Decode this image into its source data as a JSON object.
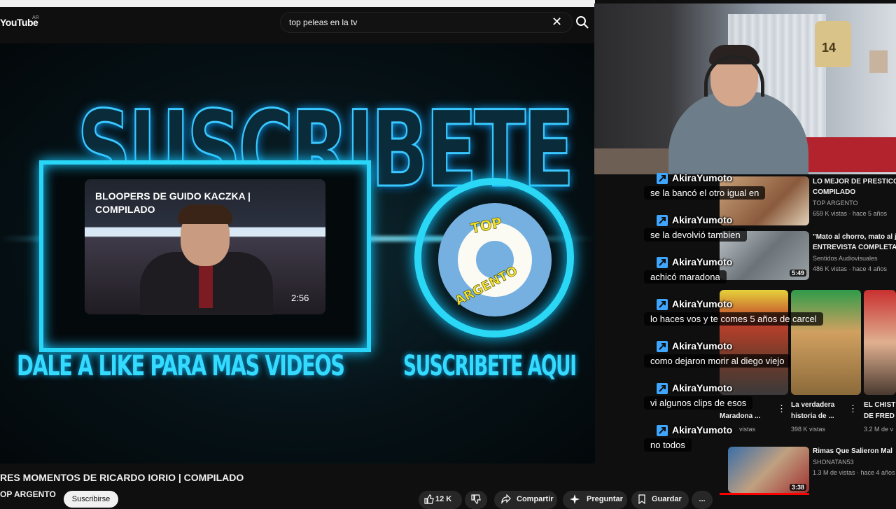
{
  "header": {
    "logo": "YouTube",
    "logo_region": "AR",
    "search_value": "top peleas en la tv"
  },
  "player": {
    "big_text": "SUSCRIBETE",
    "endscreen_video": {
      "title": "BLOOPERS DE GUIDO KACZKA | COMPILADO",
      "duration": "2:56"
    },
    "channel_logo_top": "TOP",
    "channel_logo_bottom": "ARGENTO",
    "cta_like": "DALE A LIKE PARA MAS VIDEOS",
    "cta_subscribe": "SUSCRIBETE AQUI"
  },
  "video": {
    "title": "RES MOMENTOS DE RICARDO IORIO | COMPILADO",
    "channel": "OP ARGENTO",
    "subscribe_label": "Suscribirse",
    "likes": "12 K",
    "share_label": "Compartir",
    "ask_label": "Preguntar",
    "save_label": "Guardar",
    "more_label": "..."
  },
  "webcam": {
    "jersey_number": "14"
  },
  "recommendations": [
    {
      "title1": "LO MEJOR DE PRESTICO",
      "title2": "COMPILADO",
      "channel": "TOP ARGENTO",
      "meta": "659 K vistas · hace 5 años"
    },
    {
      "title1": "\"Mato al chorro, mato al j",
      "title2": "ENTREVISTA COMPLETA",
      "channel": "Sentidos Audiovisuales",
      "meta": "486 K vistas · hace 4 años",
      "duration": "5:49"
    },
    {
      "title1": "Maradona ...",
      "channel": "",
      "meta": "vistas"
    },
    {
      "title1": "La verdadera",
      "title2": "historia de ...",
      "meta": "398 K vistas"
    },
    {
      "title1": "EL CHIST",
      "title2": "DE FRED",
      "meta": "3.2 M de v"
    },
    {
      "title1": "Rimas Que Salieron Mal",
      "channel": "SHONATAN53",
      "meta": "1.3 M de vistas · hace 4 años",
      "duration": "3:38"
    }
  ],
  "chat": [
    {
      "user": "AkiraYumoto",
      "message": "se la bancó el otro igual en"
    },
    {
      "user": "AkiraYumoto",
      "message": "se la devolvió tambien"
    },
    {
      "user": "AkiraYumoto",
      "message": "achicó maradona"
    },
    {
      "user": "AkiraYumoto",
      "message": "lo haces vos y te comes 5 años de carcel"
    },
    {
      "user": "AkiraYumoto",
      "message": "como dejaron morir al diego viejo"
    },
    {
      "user": "AkiraYumoto",
      "message": "vi algunos clips de esos"
    },
    {
      "user": "AkiraYumoto",
      "message": "no todos"
    }
  ],
  "colors": {
    "neon": "#29d6f7",
    "logo_yellow": "#f5e32d",
    "chat_badge": "#3ea6ff"
  }
}
